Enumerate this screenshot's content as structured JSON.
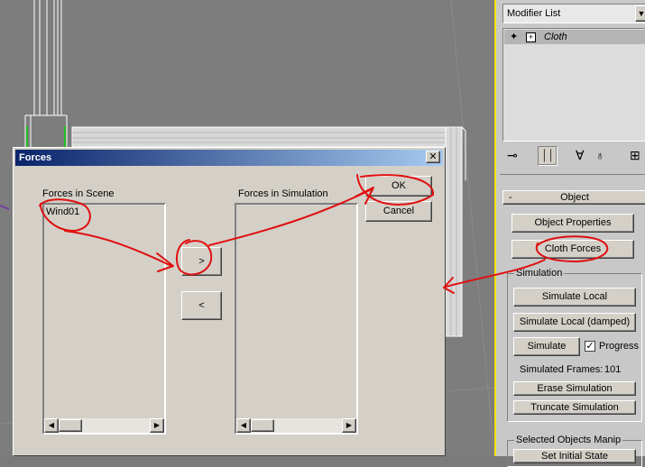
{
  "modifier_panel": {
    "modifier_list_label": "Modifier List",
    "stack_item": "Cloth",
    "rollout_title": "Object",
    "object_properties_btn": "Object Properties",
    "cloth_forces_btn": "Cloth Forces",
    "simulation_group": "Simulation",
    "simulate_local_btn": "Simulate Local",
    "simulate_local_damped_btn": "Simulate Local (damped)",
    "simulate_btn": "Simulate",
    "progress_label": "Progress",
    "progress_checked": true,
    "simulated_frames_label": "Simulated Frames:",
    "simulated_frames_value": "101",
    "erase_simulation_btn": "Erase Simulation",
    "truncate_simulation_btn": "Truncate Simulation",
    "selected_objects_group": "Selected Objects Manip",
    "set_initial_state_btn": "Set Initial State"
  },
  "dialog": {
    "title": "Forces",
    "close_glyph": "✕",
    "forces_in_scene_label": "Forces in Scene",
    "forces_in_scene_items": [
      "Wind01"
    ],
    "forces_in_simulation_label": "Forces in Simulation",
    "forces_in_simulation_items": [],
    "add_btn": ">",
    "remove_btn": "<",
    "ok_btn": "OK",
    "cancel_btn": "Cancel"
  },
  "colors": {
    "titlebar_start": "#0a246a",
    "titlebar_end": "#a6caf0",
    "annotation_ink": "#e01010",
    "viewport_bg": "#7d7d7d",
    "panel_border": "#f2e200"
  },
  "icons": [
    "pin-stack-icon",
    "show-end-result-icon",
    "make-unique-icon",
    "remove-modifier-icon",
    "configure-modifier-sets-icon",
    "lightbulb-icon",
    "expand-plus-icon",
    "dropdown-arrow-icon",
    "scroll-left-icon",
    "scroll-right-icon",
    "close-icon"
  ]
}
